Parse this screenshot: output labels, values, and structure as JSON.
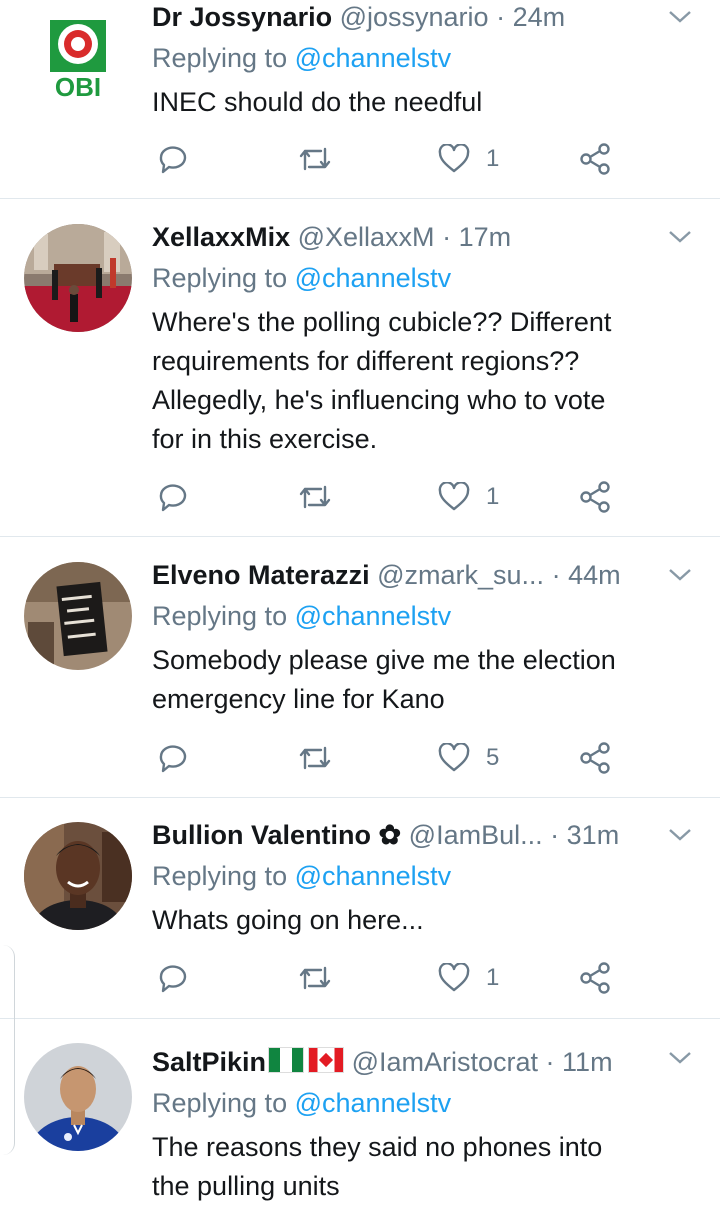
{
  "tweets": [
    {
      "name": "Dr Jossynario",
      "handle": "@jossynario",
      "sep": "·",
      "time": "24m",
      "replying_prefix": "Replying to",
      "replying_to": "@channelstv",
      "text": [
        "INEC should do the needful"
      ],
      "likes": "1",
      "avatar": "obi-logo",
      "avatar_text": "OBI"
    },
    {
      "name": "XellaxxMix",
      "handle": "@XellaxxM",
      "sep": "·",
      "time": "17m",
      "replying_prefix": "Replying to",
      "replying_to": "@channelstv",
      "text": [
        "Where's the polling cubicle?? Different",
        "requirements for different regions??",
        "Allegedly, he's influencing who to vote",
        "for in this exercise."
      ],
      "likes": "1",
      "avatar": "ceremony-photo"
    },
    {
      "name": "Elveno Materazzi",
      "handle": "@zmark_su...",
      "sep": "·",
      "time": "44m",
      "replying_prefix": "Replying to",
      "replying_to": "@channelstv",
      "text": [
        "Somebody please give me the election",
        "emergency line for Kano"
      ],
      "likes": "5",
      "avatar": "book-photo"
    },
    {
      "name": "Bullion Valentino",
      "name_suffix": "✿",
      "handle": "@IamBul...",
      "sep": "·",
      "time": "31m",
      "replying_prefix": "Replying to",
      "replying_to": "@channelstv",
      "text": [
        "Whats going on here..."
      ],
      "likes": "1",
      "avatar": "man-photo"
    },
    {
      "name": "SaltPikin",
      "flags": [
        "nigeria-flag",
        "canada-flag"
      ],
      "handle": "@IamAristocrat",
      "sep": "·",
      "time": "11m",
      "replying_prefix": "Replying to",
      "replying_to": "@channelstv",
      "text": [
        "The reasons they said no phones into",
        "the pulling units"
      ],
      "avatar": "footballer-photo"
    }
  ],
  "icons": {
    "reply": "reply-icon",
    "retweet": "retweet-icon",
    "like": "heart-icon",
    "share": "share-icon",
    "more": "chevron-down-icon"
  },
  "colors": {
    "text": "#14171a",
    "secondary": "#657786",
    "link": "#1da1f2",
    "divider": "#e1e8ed"
  }
}
